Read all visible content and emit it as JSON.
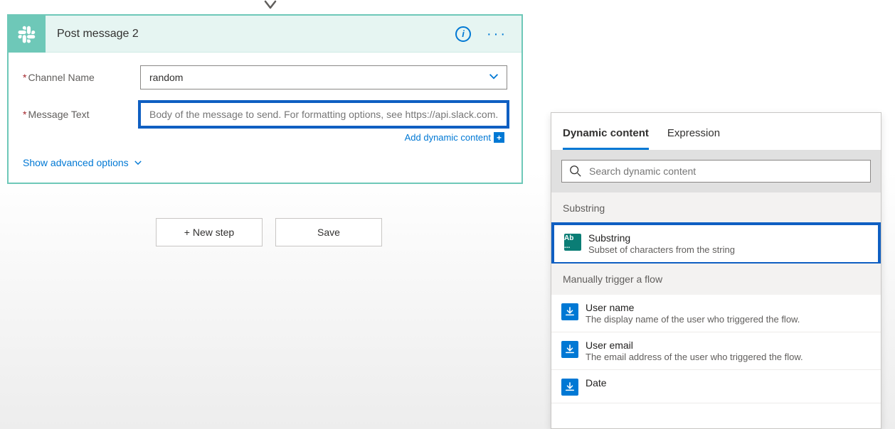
{
  "action": {
    "title": "Post message 2",
    "fields": {
      "channel_label": "Channel Name",
      "channel_value": "random",
      "message_label": "Message Text",
      "message_placeholder": "Body of the message to send. For formatting options, see https://api.slack.com."
    },
    "add_dynamic_label": "Add dynamic content",
    "advanced_label": "Show advanced options"
  },
  "buttons": {
    "new_step": "+ New step",
    "save": "Save"
  },
  "flyout": {
    "tabs": {
      "dynamic": "Dynamic content",
      "expression": "Expression"
    },
    "search_placeholder": "Search dynamic content",
    "sections": [
      {
        "header": "Substring",
        "items": [
          {
            "title": "Substring",
            "desc": "Subset of characters from the string",
            "icon": "teal",
            "highlighted": true,
            "label": "Ab ..."
          }
        ]
      },
      {
        "header": "Manually trigger a flow",
        "items": [
          {
            "title": "User name",
            "desc": "The display name of the user who triggered the flow.",
            "icon": "blue"
          },
          {
            "title": "User email",
            "desc": "The email address of the user who triggered the flow.",
            "icon": "blue"
          },
          {
            "title": "Date",
            "desc": "",
            "icon": "blue"
          }
        ]
      }
    ]
  }
}
